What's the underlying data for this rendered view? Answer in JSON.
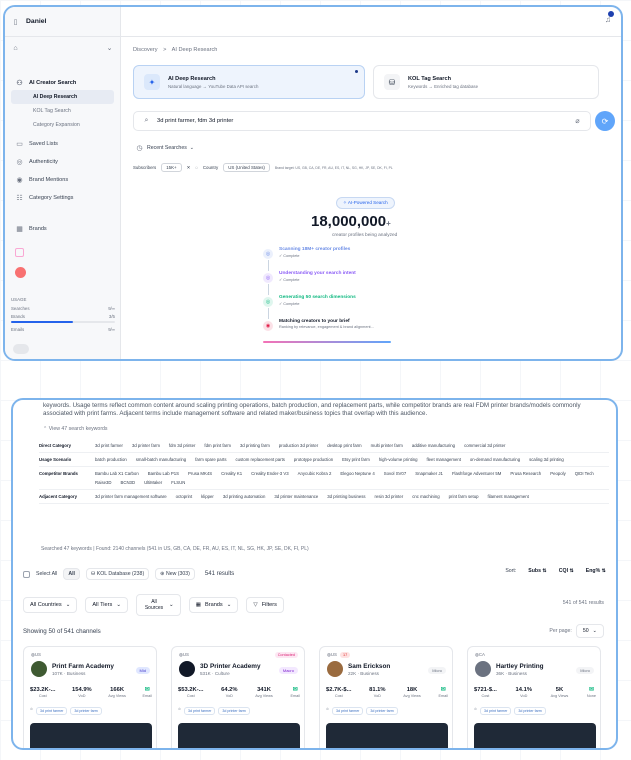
{
  "sidebar": {
    "user": "Daniel",
    "group": "AI Creator Search",
    "subitems": [
      "AI Deep Research",
      "KOL Tag Search",
      "Category Expansion"
    ],
    "items": [
      "Saved Lists",
      "Authenticity",
      "Brand Mentions",
      "Category Settings"
    ],
    "brands": "Brands",
    "usage_label": "USAGE",
    "usage": [
      {
        "label": "Searches",
        "value": "9/∞",
        "fill": 0.0
      },
      {
        "label": "Brands",
        "value": "3/5",
        "fill": 0.6
      },
      {
        "label": "Emails",
        "value": "9/∞",
        "fill": 0.0
      }
    ]
  },
  "breadcrumb": {
    "root": "Discovery",
    "sep": ">",
    "current": "AI Deep Research"
  },
  "mode_cards": [
    {
      "title": "AI Deep Research",
      "subtitle": "Natural language → YouTube Data API search"
    },
    {
      "title": "KOL Tag Search",
      "subtitle": "Keywords → Enriched tag database"
    }
  ],
  "search": {
    "value": "3d print farmer, fdm 3d printer"
  },
  "recent": "Recent Searches",
  "filters": {
    "subscribers_label": "Subscribers",
    "subscribers_value": "15K+",
    "country_label": "Country",
    "country_value": "US (United States)",
    "brand_target": "Brand target: US, GB, CA, DE, FR, AU, ES, IT, NL, SG, HK, JP, SE, DK, FI, PL"
  },
  "analysis": {
    "badge": "AI-Powered Search",
    "count": "18,000,000",
    "count_suffix": "+",
    "subtitle": "creator profiles being analyzed",
    "steps": [
      {
        "label": "Scanning 18M+ creator profiles",
        "detail": "✓ Complete",
        "color": "#6b8ce6"
      },
      {
        "label": "Understanding your search intent",
        "detail": "✓ Complete",
        "color": "#8b5cf6"
      },
      {
        "label": "Generating 50 search dimensions",
        "detail": "✓ Complete",
        "color": "#10b981"
      },
      {
        "label": "Matching creators to your brief",
        "detail": "Ranking by relevance, engagement & brand alignment...",
        "color": "#e11d48"
      }
    ]
  },
  "keywords": {
    "intro": "keywords. Usage terms reflect common content around scaling printing operations, batch production, and replacement parts, while competitor brands are real FDM printer brands/models commonly associated with print farms. Adjacent terms include management software and related maker/business topics that overlap with this audience.",
    "view_all": "View 47 search keywords",
    "rows": [
      {
        "category": "Direct Category",
        "values": [
          "3d print farmer",
          "3d printer farm",
          "fdm 3d printer",
          "fdm print farm",
          "3d printing farm",
          "production 3d printer",
          "desktop print farm",
          "multi printer farm",
          "additive manufacturing",
          "commercial 3d printer"
        ]
      },
      {
        "category": "Usage Scenario",
        "values": [
          "batch production",
          "small-batch manufacturing",
          "farm spare parts",
          "custom replacement parts",
          "prototype production",
          "Etsy print farm",
          "high-volume printing",
          "fleet management",
          "on-demand manufacturing",
          "scaling 3d printing"
        ]
      },
      {
        "category": "Competitor Brands",
        "values": [
          "Bambu Lab X1 Carbon",
          "Bambu Lab P1S",
          "Prusa MK4S",
          "Creality K1",
          "Creality Ender-3 V3",
          "Anycubic Kobra 2",
          "Elegoo Neptune 4",
          "Sovol SV07",
          "Snapmaker J1",
          "Flashforge Adventurer 5M",
          "Prusa Research",
          "Peopoly",
          "QIDI Tech",
          "Raise3D",
          "BCN3D",
          "UltiMaker",
          "FLSUN"
        ]
      },
      {
        "category": "Adjacent Category",
        "values": [
          "3d printer farm management software",
          "octoprint",
          "klipper",
          "3d printing automation",
          "3d printer maintenance",
          "3d printing business",
          "resin 3d printer",
          "cnc machining",
          "print farm setup",
          "filament management"
        ]
      }
    ],
    "found": "Searched 47 keywords | Found: 2140 channels (541 in US, GB, CA, DE, FR, AU, ES, IT, NL, SG, HK, JP, SE, DK, FI, PL)"
  },
  "results_bar": {
    "select_all": "Select All",
    "all": "All",
    "kol_db": "KOL Database (238)",
    "new": "New (303)",
    "count": "541 results",
    "sort_label": "Sort:",
    "sort_subs": "Subs ⇅",
    "sort_cqi": "CQI ⇅",
    "sort_eng": "Eng% ⇅"
  },
  "filters2": {
    "countries": "All Countries",
    "tiers": "All Tiers",
    "sources": "All Sources",
    "brands": "Brands",
    "filters": "Filters",
    "results_right": "541 of 541 results"
  },
  "showing": "Showing 50 of 541 channels",
  "per_page_label": "Per page:",
  "per_page_value": "50",
  "channels": [
    {
      "country": "US",
      "tag": "",
      "name": "Print Farm Academy",
      "subs": "107K",
      "category": "Business",
      "tier": "Mid",
      "cost": "$23.2K-...",
      "vod": "154.9%",
      "views": "166K",
      "email": "Email",
      "kw": [
        "3d print farmer",
        "3d printer farm"
      ],
      "avatar": "#3f5a32"
    },
    {
      "country": "US",
      "tag": "Contacted",
      "name": "3D Printer Academy",
      "subs": "531K",
      "category": "Culture",
      "tier": "Macro",
      "cost": "$53.2K-...",
      "vod": "64.2%",
      "views": "341K",
      "email": "Email",
      "kw": [
        "3d print farmer",
        "3d printer farm"
      ],
      "avatar": "#111827"
    },
    {
      "country": "US",
      "tag": "17",
      "name": "Sam Erickson",
      "subs": "22K",
      "category": "Business",
      "tier": "Micro",
      "cost": "$2.7K-$...",
      "vod": "81.1%",
      "views": "18K",
      "email": "Email",
      "kw": [
        "3d print farmer",
        "3d printer farm"
      ],
      "avatar": "#9a6b3f"
    },
    {
      "country": "CA",
      "tag": "",
      "name": "Hartley Printing",
      "subs": "36K",
      "category": "Business",
      "tier": "Micro",
      "cost": "$721-$...",
      "vod": "14.1%",
      "views": "5K",
      "email": "None",
      "kw": [
        "3d print farmer",
        "3d printer farm"
      ],
      "avatar": "#6b7280"
    }
  ],
  "stat_labels": {
    "cost": "Cost",
    "vod": "VoD",
    "views": "Avg Views",
    "email": "Email"
  },
  "colors": {
    "accent": "#2563eb",
    "frame": "#7db4ec"
  }
}
